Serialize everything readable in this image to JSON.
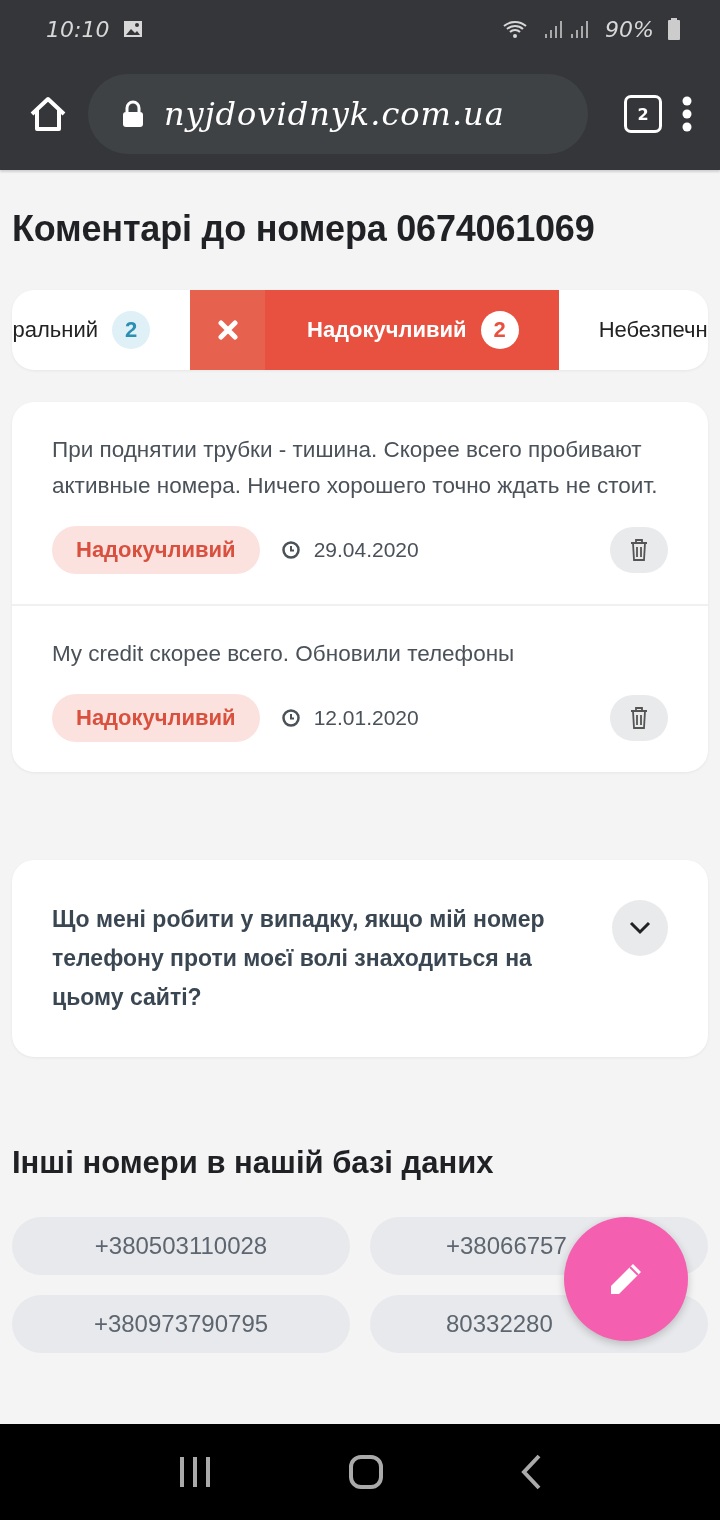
{
  "status_bar": {
    "time": "10:10",
    "battery": "90%"
  },
  "browser": {
    "url": "nyjdovidnyk.com.ua",
    "tab_count": "2"
  },
  "title": "Коментарі до номера 0674061069",
  "tabs": [
    {
      "label": "ральний",
      "count": "2",
      "selected": false
    },
    {
      "label": "Надокучливий",
      "count": "2",
      "selected": true
    },
    {
      "label": "Небезпечн",
      "selected": false
    }
  ],
  "comments": [
    {
      "text": "При поднятии трубки - тишина. Скорее всего пробивают активные номера. Ничего хорошего точно ждать не стоит.",
      "tag": "Надокучливий",
      "date": "29.04.2020"
    },
    {
      "text": "My credit скорее всего. Обновили телефоны",
      "tag": "Надокучливий",
      "date": "12.01.2020"
    }
  ],
  "faq": {
    "question": "Що мені робити у випадку, якщо мій номер телефону проти моєї волі знаходиться на цьому сайті?",
    "expanded": false
  },
  "other_numbers": {
    "title": "Інші номери в нашій базі даних",
    "numbers": [
      "+380503110028",
      "+38066757",
      "+380973790795",
      "80332280"
    ]
  }
}
